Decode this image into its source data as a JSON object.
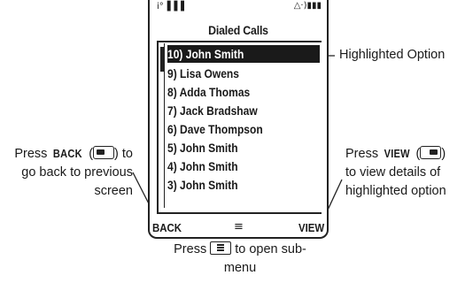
{
  "screen": {
    "title": "Dialed Calls",
    "status_left": "i°▐▐▐",
    "status_right": "△·)▮▮▮",
    "items": [
      "10) John Smith",
      "9) Lisa Owens",
      "8) Adda Thomas",
      "7) Jack Bradshaw",
      "6) Dave Thompson",
      "5) John Smith",
      "4) John Smith",
      "3) John Smith"
    ],
    "softkey_left": "BACK",
    "softkey_right": "VIEW",
    "menu_symbol": "≡"
  },
  "callouts": {
    "highlighted": "Highlighted Option",
    "back_pre": "Press ",
    "back_key": "BACK",
    "back_mid": " (",
    "back_post": ") to",
    "back_line2": "go back to previous",
    "back_line3": "screen",
    "view_pre": "Press ",
    "view_key": "VIEW",
    "view_mid": " (",
    "view_post": ")",
    "view_line2": "to view details of",
    "view_line3": "highlighted option",
    "menu_pre": "Press ",
    "menu_post": " to open sub-",
    "menu_line2": "menu"
  }
}
